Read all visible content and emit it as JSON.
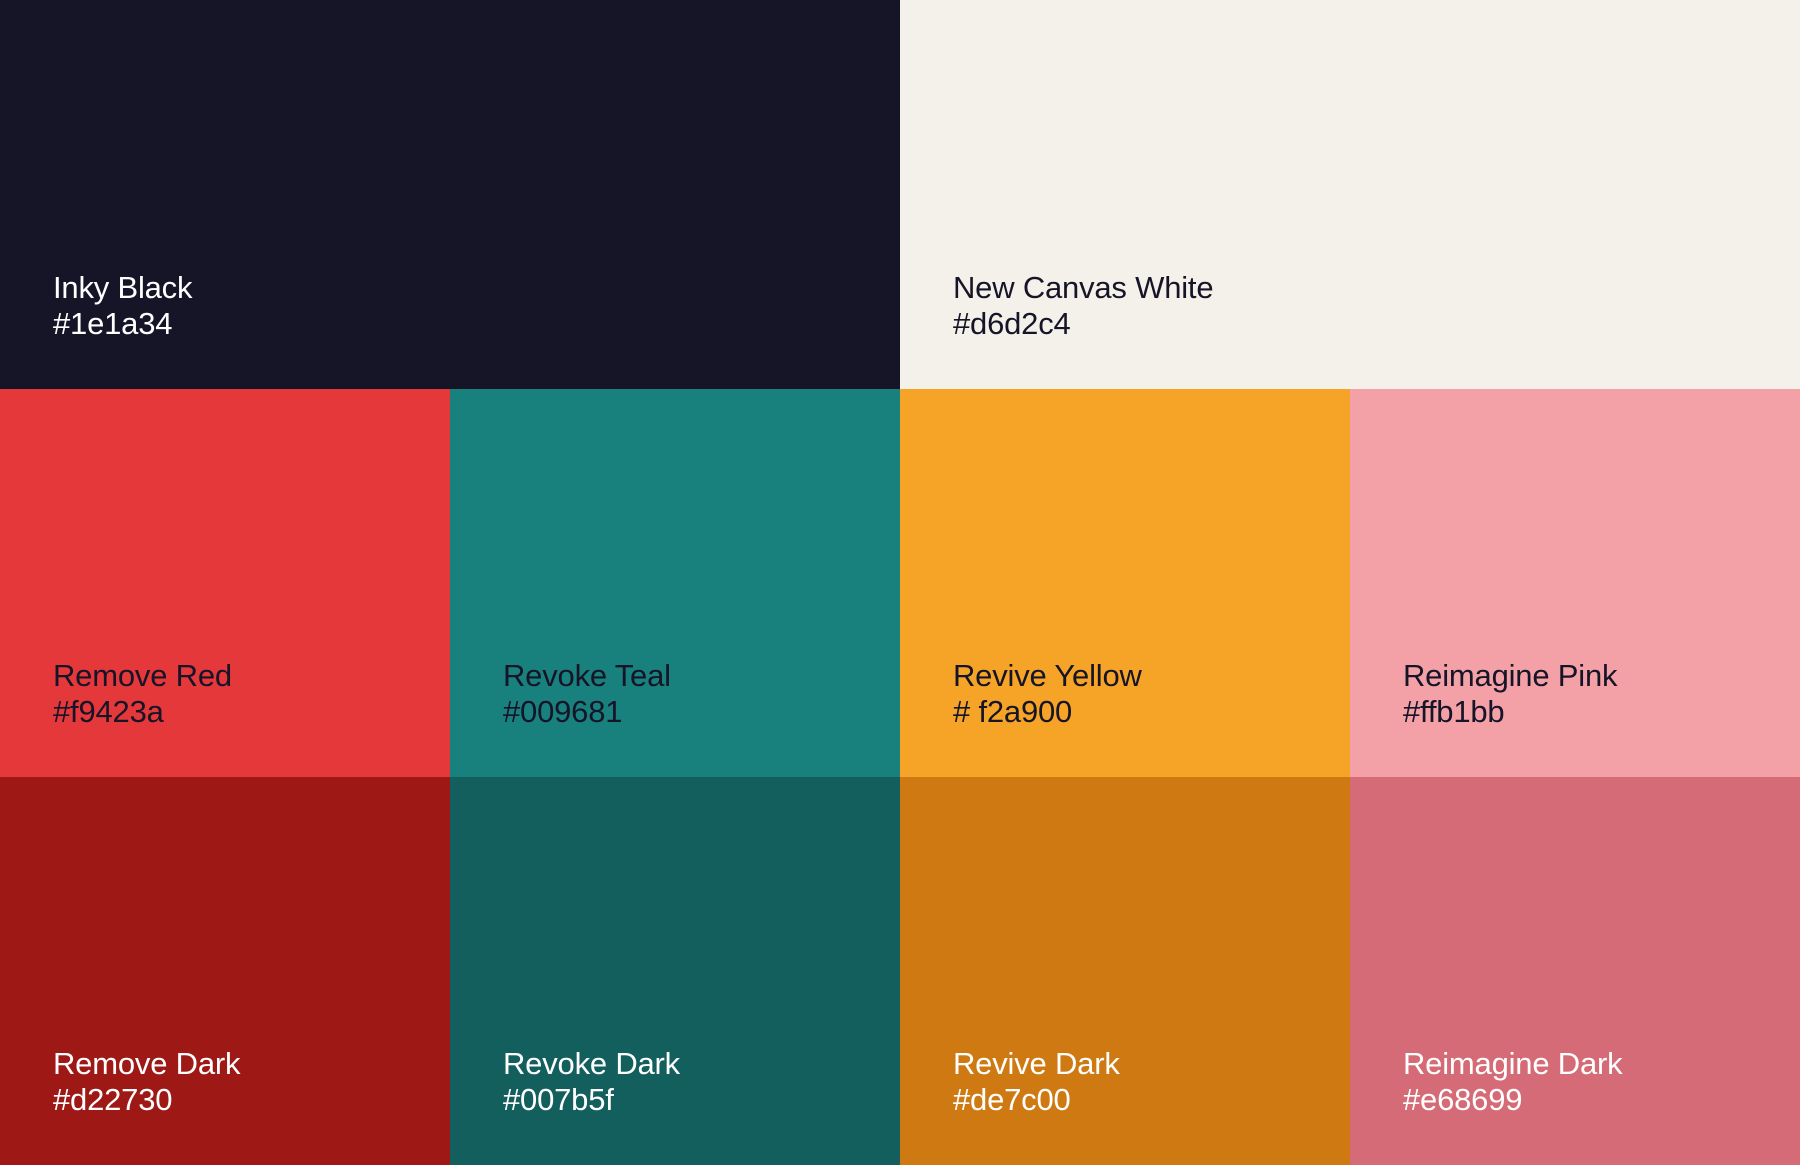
{
  "rows": [
    [
      {
        "id": "inky-black",
        "name": "Inky Black",
        "hex": "#1e1a34",
        "fill": "#161427",
        "text_color": "#ffffff",
        "wide": true
      },
      {
        "id": "new-canvas-white",
        "name": "New Canvas White",
        "hex": "#d6d2c4",
        "fill": "#f4f1ea",
        "text_color": "#161427",
        "wide": true
      }
    ],
    [
      {
        "id": "remove-red",
        "name": "Remove Red",
        "hex": "#f9423a",
        "fill": "#e5383a",
        "text_color": "#161427"
      },
      {
        "id": "revoke-teal",
        "name": "Revoke Teal",
        "hex": "#009681",
        "fill": "#18817e",
        "text_color": "#161427"
      },
      {
        "id": "revive-yellow",
        "name": "Revive Yellow",
        "hex": "# f2a900",
        "fill": "#f6a428",
        "text_color": "#161427"
      },
      {
        "id": "reimagine-pink",
        "name": "Reimagine Pink",
        "hex": "#ffb1bb",
        "fill": "#f3a1a7",
        "text_color": "#161427"
      }
    ],
    [
      {
        "id": "remove-dark",
        "name": "Remove Dark",
        "hex": "#d22730",
        "fill": "#9e1816",
        "text_color": "#ffffff"
      },
      {
        "id": "revoke-dark",
        "name": "Revoke Dark",
        "hex": "#007b5f",
        "fill": "#135f5d",
        "text_color": "#ffffff"
      },
      {
        "id": "revive-dark",
        "name": "Revive Dark",
        "hex": "#de7c00",
        "fill": "#cf7912",
        "text_color": "#ffffff"
      },
      {
        "id": "reimagine-dark",
        "name": "Reimagine Dark",
        "hex": "#e68699",
        "fill": "#d46b76",
        "text_color": "#ffffff"
      }
    ]
  ]
}
